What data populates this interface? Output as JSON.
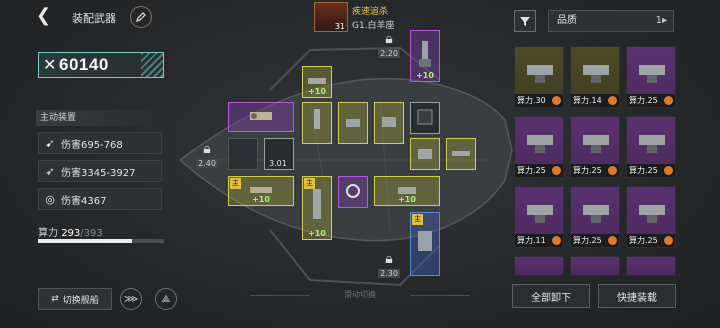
{
  "header": {
    "title": "装配武器",
    "ship_name": "疾速追杀",
    "ship_sub": "G1.白羊座",
    "ship_level": "31"
  },
  "power": {
    "value": "60140"
  },
  "active": {
    "label": "主动装置",
    "damages": [
      {
        "icon": "missile-icon",
        "text": "伤害695-768"
      },
      {
        "icon": "rocket-icon",
        "text": "伤害3345-3927"
      },
      {
        "icon": "laser-icon",
        "text": "伤害4367"
      }
    ]
  },
  "capacity": {
    "label": "算力",
    "current": "293",
    "max": "/393",
    "fraction": 0.746
  },
  "bottom": {
    "switch_ship": "切换舰船",
    "slide_hint": "滑动切换"
  },
  "slots": {
    "locks": [
      "2.20",
      "2.40",
      "2.30"
    ],
    "badge_level": "3.01",
    "plus": "+10",
    "main_tag": "主"
  },
  "right": {
    "quality_label": "品质",
    "sort_icon": "sort-icon",
    "cards": [
      {
        "color": "y",
        "power": "算力.30"
      },
      {
        "color": "y",
        "power": "算力.14"
      },
      {
        "color": "p",
        "power": "算力.25"
      },
      {
        "color": "p",
        "power": "算力.25"
      },
      {
        "color": "p",
        "power": "算力.25"
      },
      {
        "color": "p",
        "power": "算力.25"
      },
      {
        "color": "p",
        "power": "算力.11"
      },
      {
        "color": "p",
        "power": "算力.25"
      },
      {
        "color": "p",
        "power": "算力.25"
      }
    ],
    "unload_all": "全部卸下",
    "quick_equip": "快捷装载"
  }
}
